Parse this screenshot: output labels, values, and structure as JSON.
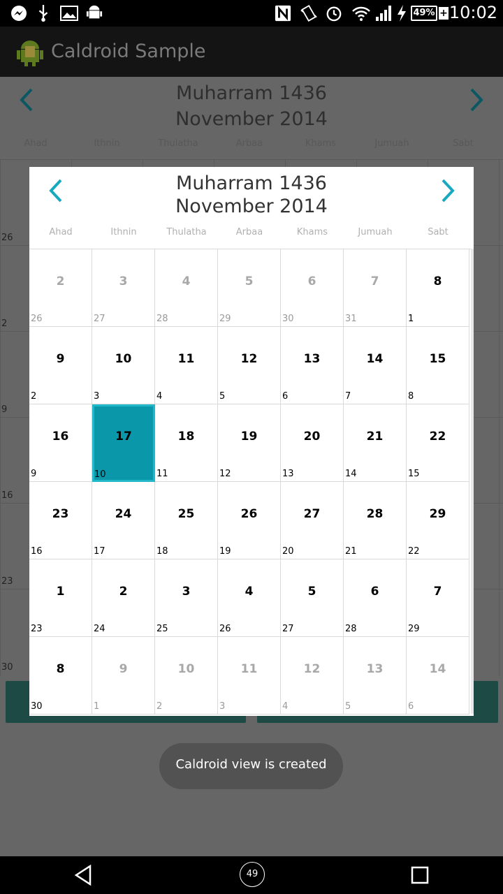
{
  "status_bar": {
    "time": "10:02",
    "battery": "49%",
    "icons": [
      "messenger-icon",
      "usb-icon",
      "image-icon",
      "android-icon",
      "nfc-icon",
      "vibrate-icon",
      "alarm-icon",
      "wifi-icon",
      "signal-icon",
      "charging-icon"
    ]
  },
  "app": {
    "title": "Caldroid Sample"
  },
  "background_calendar": {
    "title_hijri": "Muharram 1436",
    "title_gregorian": "November 2014",
    "weekdays": [
      "Ahad",
      "Ithnin",
      "Thulatha",
      "Arbaa",
      "Khams",
      "Jumuah",
      "Sabt"
    ],
    "left_numbers": [
      "26",
      "2",
      "9",
      "16",
      "23",
      "30"
    ]
  },
  "dialog": {
    "title_hijri": "Muharram 1436",
    "title_gregorian": "November 2014",
    "weekdays": [
      "Ahad",
      "Ithnin",
      "Thulatha",
      "Arbaa",
      "Khams",
      "Jumuah",
      "Sabt"
    ],
    "selected": "17",
    "weeks": [
      [
        {
          "g": "2",
          "h": "26",
          "o": true
        },
        {
          "g": "3",
          "h": "27",
          "o": true
        },
        {
          "g": "4",
          "h": "28",
          "o": true
        },
        {
          "g": "5",
          "h": "29",
          "o": true
        },
        {
          "g": "6",
          "h": "30",
          "o": true
        },
        {
          "g": "7",
          "h": "31",
          "o": true
        },
        {
          "g": "8",
          "h": "1",
          "o": false
        }
      ],
      [
        {
          "g": "9",
          "h": "2",
          "o": false
        },
        {
          "g": "10",
          "h": "3",
          "o": false
        },
        {
          "g": "11",
          "h": "4",
          "o": false
        },
        {
          "g": "12",
          "h": "5",
          "o": false
        },
        {
          "g": "13",
          "h": "6",
          "o": false
        },
        {
          "g": "14",
          "h": "7",
          "o": false
        },
        {
          "g": "15",
          "h": "8",
          "o": false
        }
      ],
      [
        {
          "g": "16",
          "h": "9",
          "o": false
        },
        {
          "g": "17",
          "h": "10",
          "o": false,
          "sel": true
        },
        {
          "g": "18",
          "h": "11",
          "o": false
        },
        {
          "g": "19",
          "h": "12",
          "o": false
        },
        {
          "g": "20",
          "h": "13",
          "o": false
        },
        {
          "g": "21",
          "h": "14",
          "o": false
        },
        {
          "g": "22",
          "h": "15",
          "o": false
        }
      ],
      [
        {
          "g": "23",
          "h": "16",
          "o": false
        },
        {
          "g": "24",
          "h": "17",
          "o": false
        },
        {
          "g": "25",
          "h": "18",
          "o": false
        },
        {
          "g": "26",
          "h": "19",
          "o": false
        },
        {
          "g": "27",
          "h": "20",
          "o": false
        },
        {
          "g": "28",
          "h": "21",
          "o": false
        },
        {
          "g": "29",
          "h": "22",
          "o": false
        }
      ],
      [
        {
          "g": "1",
          "h": "23",
          "o": false
        },
        {
          "g": "2",
          "h": "24",
          "o": false
        },
        {
          "g": "3",
          "h": "25",
          "o": false
        },
        {
          "g": "4",
          "h": "26",
          "o": false
        },
        {
          "g": "5",
          "h": "27",
          "o": false
        },
        {
          "g": "6",
          "h": "28",
          "o": false
        },
        {
          "g": "7",
          "h": "29",
          "o": false
        }
      ],
      [
        {
          "g": "8",
          "h": "30",
          "o": false
        },
        {
          "g": "9",
          "h": "1",
          "o": true
        },
        {
          "g": "10",
          "h": "2",
          "o": true
        },
        {
          "g": "11",
          "h": "3",
          "o": true
        },
        {
          "g": "12",
          "h": "4",
          "o": true
        },
        {
          "g": "13",
          "h": "5",
          "o": true
        },
        {
          "g": "14",
          "h": "6",
          "o": true
        }
      ]
    ]
  },
  "toast": {
    "text": "Caldroid view is created"
  },
  "nav": {
    "home_badge": "49"
  },
  "colors": {
    "accent": "#0997a9",
    "arrow": "#17a9bd",
    "toast_bg": "#525252"
  }
}
